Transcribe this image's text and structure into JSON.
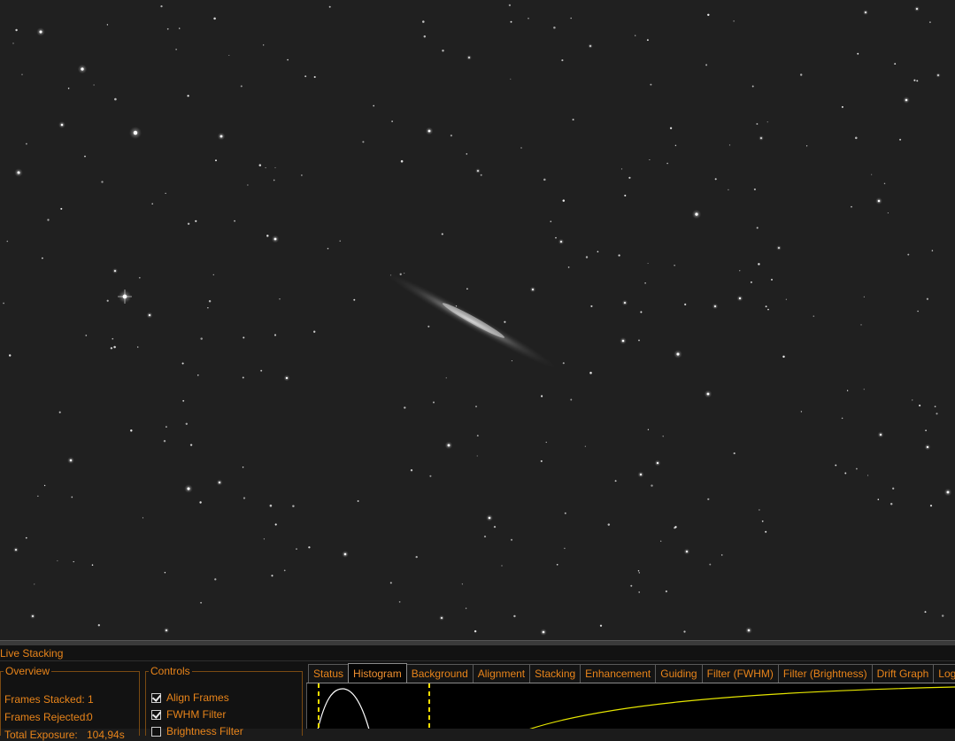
{
  "panel": {
    "title": "Live Stacking"
  },
  "overview": {
    "legend": "Overview",
    "rows": [
      {
        "label": "Frames Stacked:",
        "value": "1"
      },
      {
        "label": "Frames Rejected:",
        "value": "0"
      },
      {
        "label": "Total Exposure:",
        "value": "104,94s"
      }
    ]
  },
  "controls": {
    "legend": "Controls",
    "items": [
      {
        "label": "Align Frames",
        "checked": true
      },
      {
        "label": "FWHM Filter",
        "checked": true
      },
      {
        "label": "Brightness Filter",
        "checked": false
      }
    ]
  },
  "tabs": [
    {
      "label": "Status",
      "active": false
    },
    {
      "label": "Histogram",
      "active": true
    },
    {
      "label": "Background",
      "active": false
    },
    {
      "label": "Alignment",
      "active": false
    },
    {
      "label": "Stacking",
      "active": false
    },
    {
      "label": "Enhancement",
      "active": false
    },
    {
      "label": "Guiding",
      "active": false
    },
    {
      "label": "Filter (FWHM)",
      "active": false
    },
    {
      "label": "Filter (Brightness)",
      "active": false
    },
    {
      "label": "Drift Graph",
      "active": false
    },
    {
      "label": "Log",
      "active": false
    }
  ],
  "colors": {
    "accent": "#e8841a",
    "histogram_curve": "#ffffff",
    "stretch_curve": "#e6e600",
    "marker": "#ffe000"
  }
}
